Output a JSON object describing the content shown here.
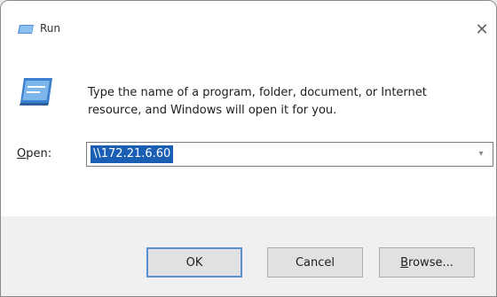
{
  "window": {
    "title": "Run",
    "close_glyph": "✕"
  },
  "dialog": {
    "description": "Type the name of a program, folder, document, or Internet resource, and Windows will open it for you.",
    "open_label_first": "O",
    "open_label_rest": "pen:",
    "open_value": "\\\\172.21.6.60",
    "dropdown_glyph": "▾"
  },
  "buttons": {
    "ok": "OK",
    "cancel": "Cancel",
    "browse_first": "B",
    "browse_rest": "rowse..."
  },
  "icons": {
    "title": "run-app-icon",
    "body": "run-app-icon-large",
    "close": "close-icon",
    "dropdown": "chevron-down-icon"
  },
  "colors": {
    "selection": "#1a5fb4",
    "default_button_border": "#5a8fd6",
    "footer_background": "#f0f0f0"
  }
}
